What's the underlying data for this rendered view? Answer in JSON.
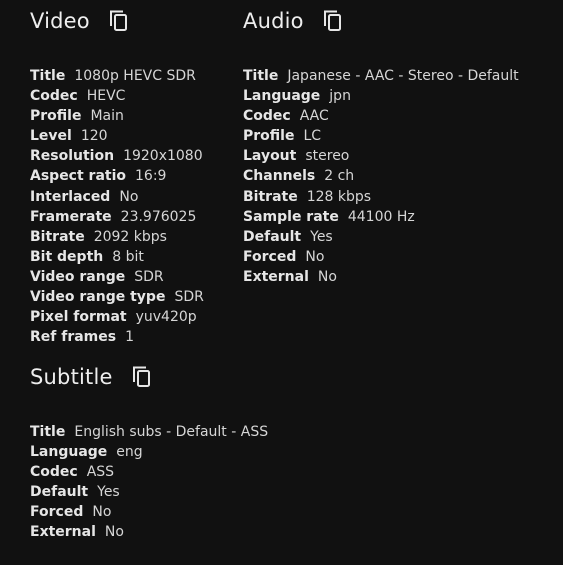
{
  "video": {
    "title": "Video",
    "copy_icon": "copy-icon",
    "rows": [
      {
        "label": "Title",
        "value": "1080p HEVC SDR"
      },
      {
        "label": "Codec",
        "value": "HEVC"
      },
      {
        "label": "Profile",
        "value": "Main"
      },
      {
        "label": "Level",
        "value": "120"
      },
      {
        "label": "Resolution",
        "value": "1920x1080"
      },
      {
        "label": "Aspect ratio",
        "value": "16:9"
      },
      {
        "label": "Interlaced",
        "value": "No"
      },
      {
        "label": "Framerate",
        "value": "23.976025"
      },
      {
        "label": "Bitrate",
        "value": "2092 kbps"
      },
      {
        "label": "Bit depth",
        "value": "8 bit"
      },
      {
        "label": "Video range",
        "value": "SDR"
      },
      {
        "label": "Video range type",
        "value": "SDR"
      },
      {
        "label": "Pixel format",
        "value": "yuv420p"
      },
      {
        "label": "Ref frames",
        "value": "1"
      }
    ]
  },
  "audio": {
    "title": "Audio",
    "copy_icon": "copy-icon",
    "rows": [
      {
        "label": "Title",
        "value": "Japanese - AAC - Stereo - Default"
      },
      {
        "label": "Language",
        "value": "jpn"
      },
      {
        "label": "Codec",
        "value": "AAC"
      },
      {
        "label": "Profile",
        "value": "LC"
      },
      {
        "label": "Layout",
        "value": "stereo"
      },
      {
        "label": "Channels",
        "value": "2 ch"
      },
      {
        "label": "Bitrate",
        "value": "128 kbps"
      },
      {
        "label": "Sample rate",
        "value": "44100 Hz"
      },
      {
        "label": "Default",
        "value": "Yes"
      },
      {
        "label": "Forced",
        "value": "No"
      },
      {
        "label": "External",
        "value": "No"
      }
    ]
  },
  "subtitle": {
    "title": "Subtitle",
    "copy_icon": "copy-icon",
    "rows": [
      {
        "label": "Title",
        "value": "English subs - Default - ASS"
      },
      {
        "label": "Language",
        "value": "eng"
      },
      {
        "label": "Codec",
        "value": "ASS"
      },
      {
        "label": "Default",
        "value": "Yes"
      },
      {
        "label": "Forced",
        "value": "No"
      },
      {
        "label": "External",
        "value": "No"
      }
    ]
  },
  "colors": {
    "background": "#111111",
    "text": "#e6e6e6"
  }
}
